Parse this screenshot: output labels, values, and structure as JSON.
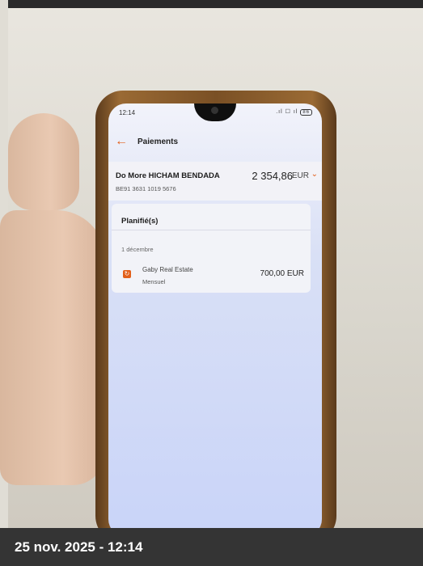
{
  "phone": {
    "status_time": "12:14",
    "status_icons": ".ıl ☐ ıl",
    "battery": "86"
  },
  "app": {
    "back_icon": "arrow-left-icon",
    "title": "Paiements"
  },
  "account": {
    "name": "Do More HICHAM BENDADA",
    "iban": "BE91 3631 1019 5676",
    "balance": "2 354,86",
    "currency": "EUR",
    "chevron_icon": "chevron-down-icon"
  },
  "scheduled": {
    "title": "Planifié(s)",
    "date": "1 décembre",
    "payment": {
      "icon": "calendar-repeat-icon",
      "name": "Gaby Real Estate",
      "frequency": "Mensuel",
      "amount": "700,00 EUR"
    }
  },
  "caption": {
    "text": "25 nov. 2025 - 12:14"
  },
  "colors": {
    "accent": "#e2601b",
    "caption_bg": "#343434"
  }
}
